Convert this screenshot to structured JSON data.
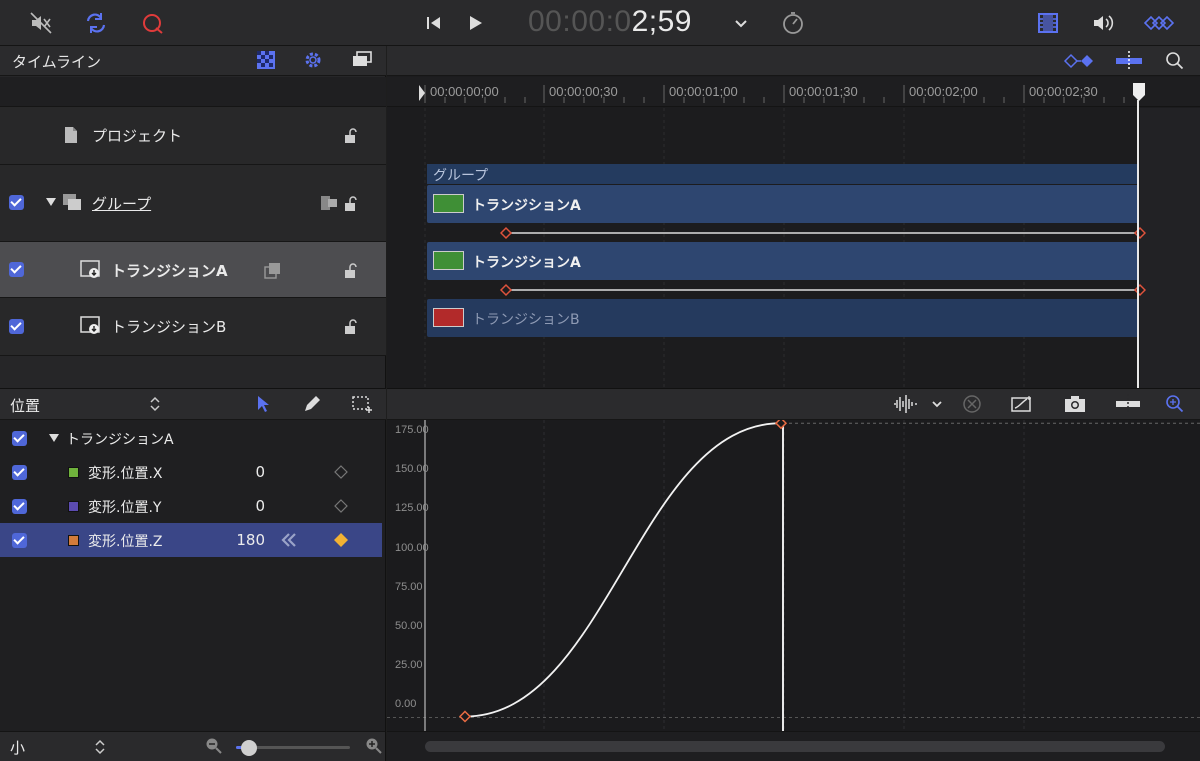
{
  "toolbar": {
    "timecode_dim": "00:00:0",
    "timecode_lit": "2;59",
    "colors": {
      "accent": "#5b72f0",
      "record": "#e03b3b"
    }
  },
  "timeline_panel": {
    "title": "タイムライン",
    "layers": [
      {
        "label": "プロジェクト",
        "checked": false
      },
      {
        "label": "グループ",
        "checked": true
      },
      {
        "label": "トランジションA",
        "checked": true,
        "selected": true
      },
      {
        "label": "トランジションB",
        "checked": true
      }
    ]
  },
  "ruler": {
    "ticks": [
      "00:00:00;00",
      "00:00:00;30",
      "00:00:01;00",
      "00:00:01;30",
      "00:00:02;00",
      "00:00:02;30"
    ]
  },
  "tracks": {
    "group_label": "グループ",
    "bars": [
      {
        "label": "トランジションA",
        "thumb_color": "#3f8f36"
      },
      {
        "label": "トランジションA",
        "thumb_color": "#3f8f36"
      },
      {
        "label": "トランジションB",
        "thumb_color": "#b22a2a"
      }
    ]
  },
  "params_header": {
    "selector_label": "位置"
  },
  "params": {
    "group_label": "トランジションA",
    "rows": [
      {
        "name": "変形.位置.X",
        "value": "0",
        "swatch": "#6fb23c"
      },
      {
        "name": "変形.位置.Y",
        "value": "0",
        "swatch": "#5b4bb0"
      },
      {
        "name": "変形.位置.Z",
        "value": "180",
        "swatch": "#d27b3a",
        "selected": true
      }
    ]
  },
  "chart_data": {
    "type": "line",
    "y_ticks": [
      "175.00",
      "150.00",
      "125.00",
      "100.00",
      "75.00",
      "50.00",
      "25.00",
      "0.00"
    ],
    "ylim": [
      0,
      175
    ],
    "series": [
      {
        "keyframes": [
          {
            "time": "00:00:00;10",
            "value": -8
          },
          {
            "time": "00:00:02;29",
            "value": 180
          }
        ]
      }
    ]
  },
  "bottom": {
    "size_label": "小"
  }
}
